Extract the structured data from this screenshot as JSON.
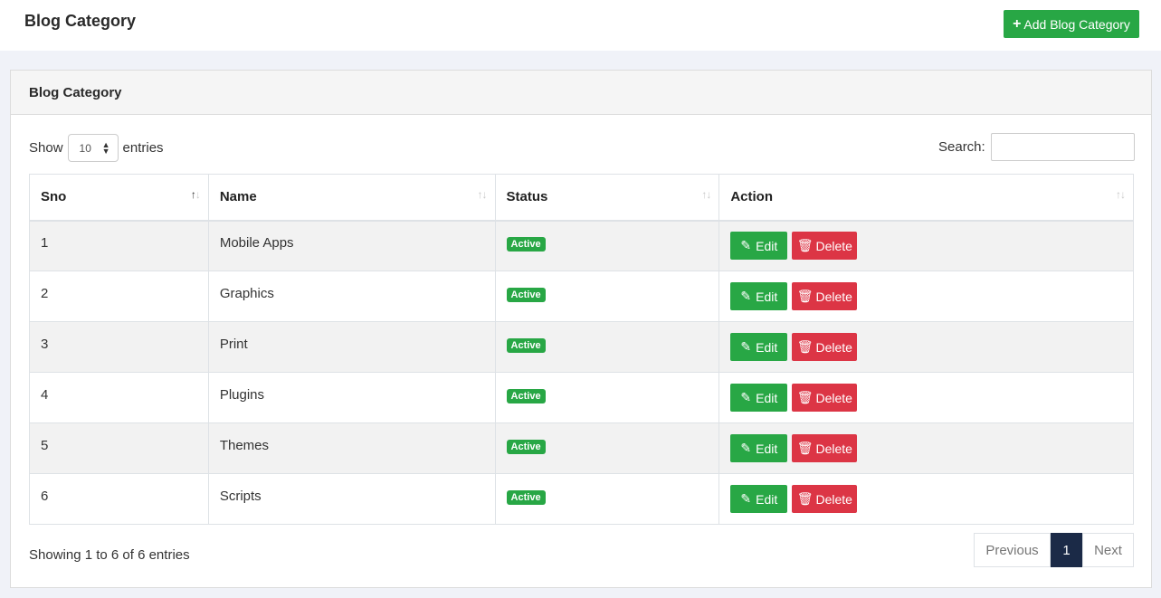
{
  "page": {
    "title": "Blog Category",
    "add_button_label": "Add Blog Category"
  },
  "card": {
    "title": "Blog Category"
  },
  "controls": {
    "show_label": "Show",
    "length_value": "10",
    "entries_label": "entries",
    "search_label": "Search:",
    "search_value": ""
  },
  "table": {
    "headers": [
      "Sno",
      "Name",
      "Status",
      "Action"
    ],
    "rows": [
      {
        "sno": "1",
        "name": "Mobile Apps",
        "status": "Active"
      },
      {
        "sno": "2",
        "name": "Graphics",
        "status": "Active"
      },
      {
        "sno": "3",
        "name": "Print",
        "status": "Active"
      },
      {
        "sno": "4",
        "name": "Plugins",
        "status": "Active"
      },
      {
        "sno": "5",
        "name": "Themes",
        "status": "Active"
      },
      {
        "sno": "6",
        "name": "Scripts",
        "status": "Active"
      }
    ],
    "edit_label": "Edit",
    "delete_label": "Delete"
  },
  "footer": {
    "info": "Showing 1 to 6 of 6 entries",
    "prev_label": "Previous",
    "current_page": "1",
    "next_label": "Next"
  },
  "colors": {
    "success": "#28a745",
    "danger": "#dc3545",
    "active_page": "#1b2a47"
  },
  "icons": {
    "add": "plus-icon",
    "edit": "edit-icon",
    "delete": "trash-icon",
    "sort": "sort-icon"
  }
}
